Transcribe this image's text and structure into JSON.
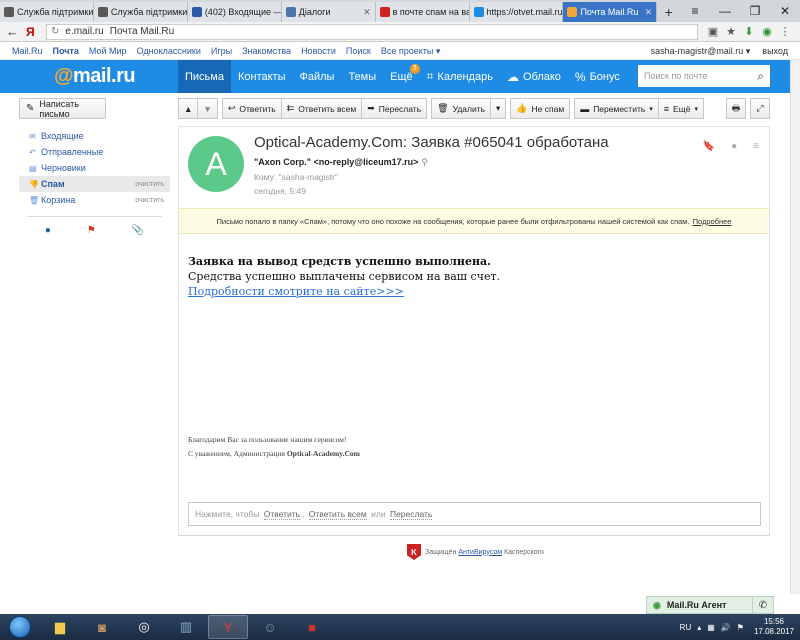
{
  "browser": {
    "tabs": [
      {
        "title": "Служба підтримки S",
        "icon_color": "#5a5a5a"
      },
      {
        "title": "Служба підтримки S",
        "icon_color": "#5a5a5a"
      },
      {
        "title": "(402) Входящие — Я",
        "icon_color": "#2b58a8"
      },
      {
        "title": "Діалоги",
        "icon_color": "#4a76a8"
      },
      {
        "title": "в почте спам на ваш",
        "icon_color": "#cc2222"
      },
      {
        "title": "https://otvet.mail.ru",
        "icon_color": "#1e8be4"
      },
      {
        "title": "Почта Mail.Ru",
        "icon_color": "#f2a33a",
        "active": true
      }
    ],
    "new_tab": "+",
    "window_controls": [
      "≡",
      "—",
      "❐",
      "✕"
    ],
    "url_domain": "e.mail.ru",
    "page_title": "Почта Mail.Ru",
    "ya_logo": "Я"
  },
  "portal": {
    "links": [
      "Mail.Ru",
      "Почта",
      "Мой Мир",
      "Одноклассники",
      "Игры",
      "Знакомства",
      "Новости",
      "Поиск",
      "Все проекты ▾"
    ],
    "user": "sasha-magistr@mail.ru ▾",
    "logout": "выход"
  },
  "header": {
    "logo_at": "@",
    "logo_text": "mail.ru",
    "nav": [
      {
        "label": "Письма",
        "active": true
      },
      {
        "label": "Контакты"
      },
      {
        "label": "Файлы"
      },
      {
        "label": "Темы"
      },
      {
        "label": "Ещё",
        "badge": "3"
      },
      {
        "label": "Календарь",
        "icon": "⌗"
      },
      {
        "label": "Облако",
        "icon": "☁"
      },
      {
        "label": "Бонус",
        "icon": "%"
      }
    ],
    "search_placeholder": "Поиск по почте"
  },
  "toolbar": {
    "compose": "Написать письмо",
    "up": "▲",
    "down": "▼",
    "reply": "Ответить",
    "reply_all": "Ответить всем",
    "forward": "Переслать",
    "delete": "Удалить",
    "not_spam": "Не спам",
    "move": "Переместить",
    "more": "Ещё"
  },
  "sidebar": {
    "folders": [
      {
        "label": "Входящие",
        "icon": "✉"
      },
      {
        "label": "Отправленные",
        "icon": "↶"
      },
      {
        "label": "Черновики",
        "icon": "▤"
      },
      {
        "label": "Спам",
        "icon": "👎",
        "active": true,
        "clear": "очистить"
      },
      {
        "label": "Корзина",
        "icon": "🗑",
        "clear": "очистить"
      }
    ]
  },
  "letter": {
    "avatar_letter": "A",
    "subject": "Optical-Academy.Com: Заявка #065041 обработана",
    "from": "\"Axon Corp.\" <no-reply@liceum17.ru>",
    "to": "Кому: \"sasha-magistr\"",
    "date": "сегодня, 5:49",
    "spam_notice": "Письмо попало в папку «Спам», потому что оно похоже на сообщения, которые ранее были отфильтрованы нашей системой как спам.",
    "spam_more": "Подробнее",
    "body_line1": "Заявка на вывод средств успешно выполнена.",
    "body_line2": "Средства успешно выплачены сервисом на ваш счет.",
    "body_link": "Подробности смотрите на сайте>>>",
    "footer_line1": "Благодарим Вас за пользование нашим сервисом!",
    "footer_line2_prefix": "С уважением, Администрация ",
    "footer_line2_brand": "Optical-Academy.Com",
    "reply_prefix": "Нажмите, чтобы",
    "reply_link1": "Ответить",
    "reply_sep1": ",",
    "reply_link2": "Ответить всем",
    "reply_sep2": "или",
    "reply_link3": "Переслать"
  },
  "kaspersky": {
    "prefix": "Защищён",
    "link": "АнтиВирусом",
    "suffix": "Касперского"
  },
  "agent": {
    "label": "Mail.Ru Агент"
  },
  "taskbar": {
    "lang": "RU",
    "time": "15:56",
    "date": "17.08.2017"
  }
}
